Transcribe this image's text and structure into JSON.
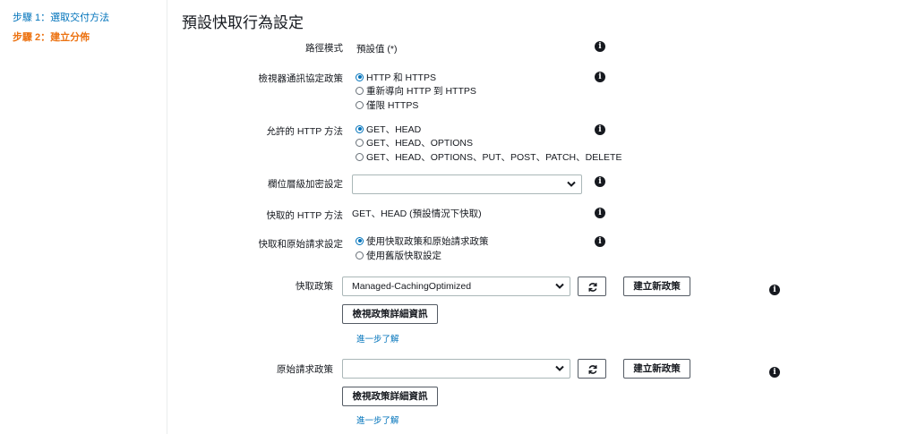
{
  "sidebar": {
    "step1": "步驟 1：選取交付方法",
    "step2": "步驟 2：建立分佈"
  },
  "page_title": "預設快取行為設定",
  "path_pattern": {
    "label": "路徑模式",
    "value": "預設值 (*)"
  },
  "viewer_protocol": {
    "label": "檢視器通訊協定政策",
    "options": [
      "HTTP 和 HTTPS",
      "重新導向 HTTP 到 HTTPS",
      "僅限 HTTPS"
    ],
    "selected": 0
  },
  "allowed_methods": {
    "label": "允許的 HTTP 方法",
    "options": [
      "GET、HEAD",
      "GET、HEAD、OPTIONS",
      "GET、HEAD、OPTIONS、PUT、POST、PATCH、DELETE"
    ],
    "selected": 0
  },
  "field_encryption": {
    "label": "欄位層級加密設定",
    "value": ""
  },
  "cached_methods": {
    "label": "快取的 HTTP 方法",
    "value": "GET、HEAD (預設情況下快取)"
  },
  "cache_origin": {
    "label": "快取和原始請求設定",
    "options": [
      "使用快取政策和原始請求政策",
      "使用舊版快取設定"
    ],
    "selected": 0
  },
  "cache_policy": {
    "label": "快取政策",
    "value": "Managed-CachingOptimized",
    "create_label": "建立新政策",
    "details_label": "檢視政策詳細資訊",
    "learn_more": "進一步了解"
  },
  "origin_request_policy": {
    "label": "原始請求政策",
    "value": "",
    "create_label": "建立新政策",
    "details_label": "檢視政策詳細資訊",
    "learn_more": "進一步了解"
  },
  "icons": {
    "info": "info-icon",
    "refresh": "refresh-icon",
    "chevron": "chevron-down-icon"
  },
  "colors": {
    "link": "#0073bb",
    "active_step": "#ec7211",
    "text": "#16191f"
  }
}
